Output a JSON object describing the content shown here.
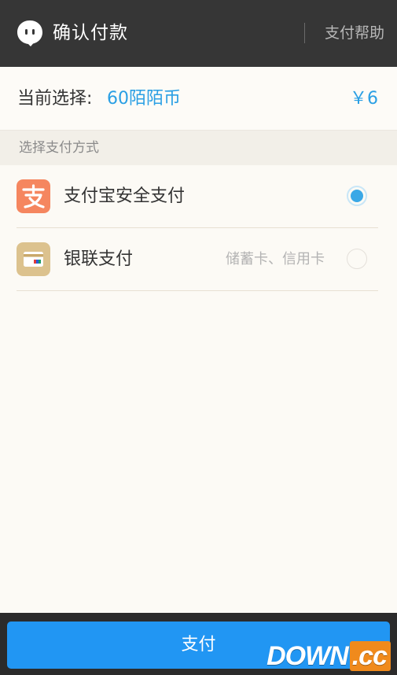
{
  "header": {
    "title": "确认付款",
    "help_label": "支付帮助",
    "app_icon": "chat-bubble-icon"
  },
  "selection": {
    "label": "当前选择:",
    "item": "60陌陌币",
    "price": "￥6",
    "accent_color": "#2a9fe4"
  },
  "section": {
    "title": "选择支付方式"
  },
  "payment_methods": [
    {
      "name": "支付宝安全支付",
      "description": "",
      "icon": "alipay-icon",
      "icon_color": "#f5865f",
      "selected": true
    },
    {
      "name": "银联支付",
      "description": "储蓄卡、信用卡",
      "icon": "unionpay-card-icon",
      "icon_color": "#dcc28e",
      "selected": false
    }
  ],
  "footer": {
    "pay_label": "支付",
    "button_color": "#2196f3"
  },
  "watermark": {
    "text": "DOWN",
    "suffix": ".cc"
  }
}
